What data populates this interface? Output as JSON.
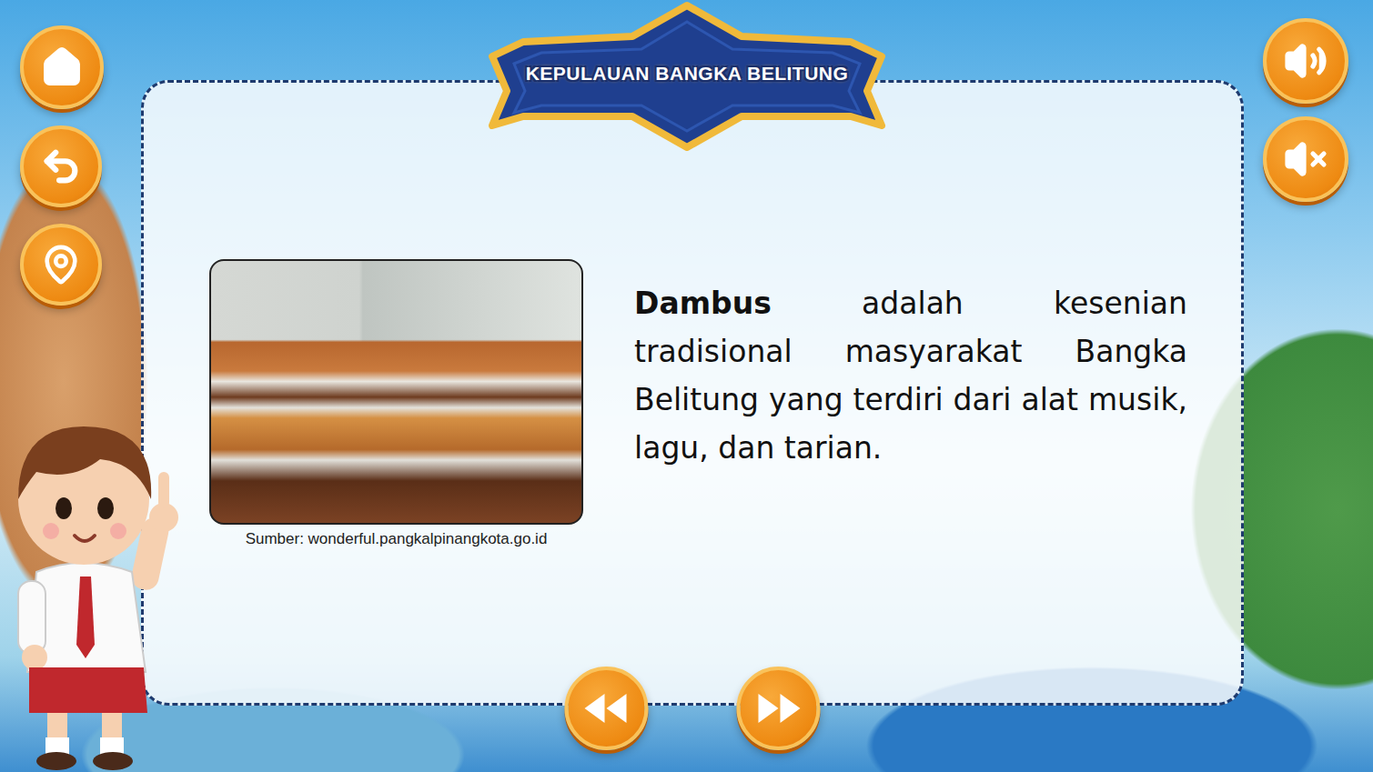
{
  "header": {
    "title": "KEPULAUAN BANGKA BELITUNG"
  },
  "content": {
    "term": "Dambus",
    "description": " adalah kesenian tradisional masyarakat Bangka Belitung yang terdiri dari alat musik, lagu, dan tarian.",
    "photo": {
      "caption": "Sumber: wonderful.pangkalpinangkota.go.id"
    }
  }
}
